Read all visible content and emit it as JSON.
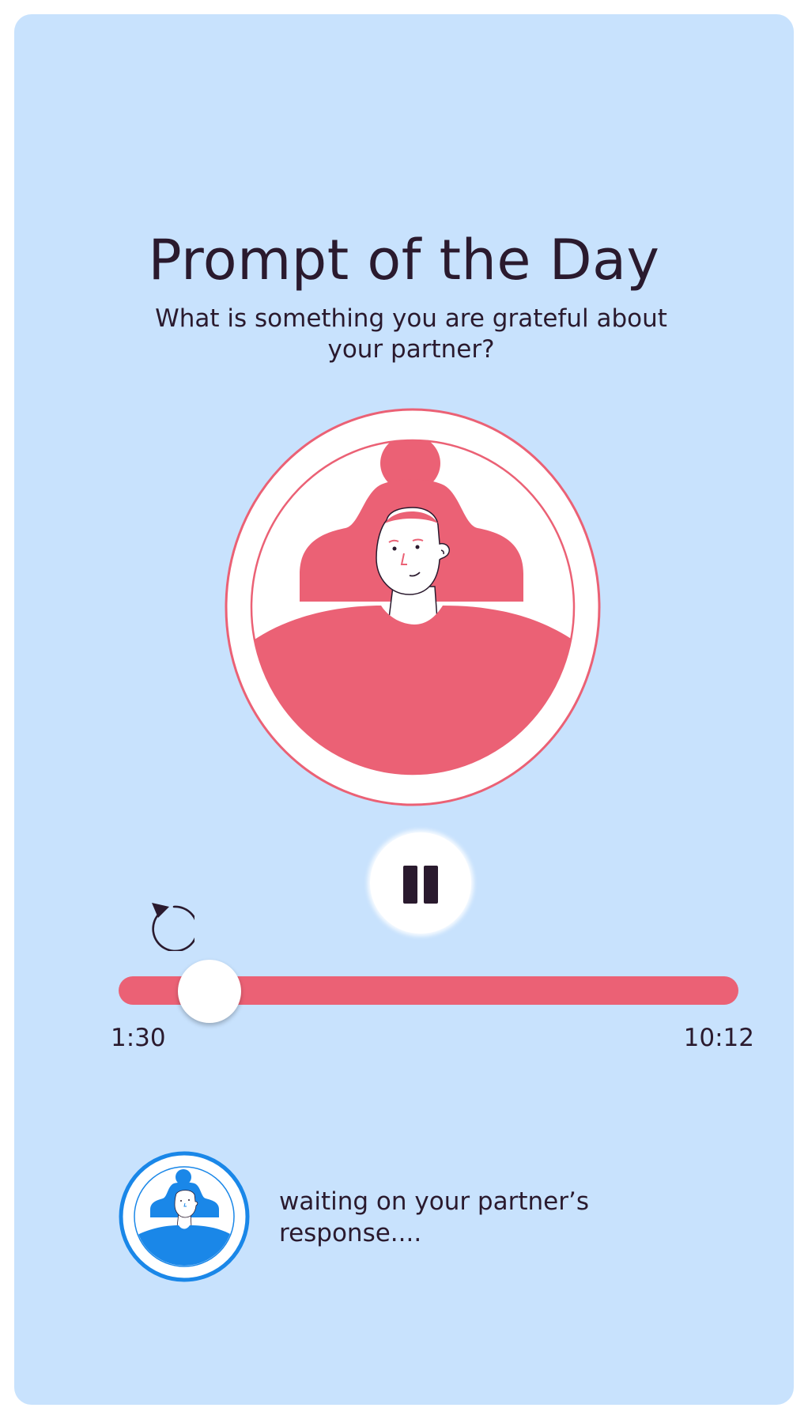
{
  "prompt": {
    "title": "Prompt of the Day",
    "question": "What is something you are grateful about your partner?"
  },
  "player": {
    "pause_icon": "pause-icon",
    "replay_icon": "replay-icon",
    "elapsed": "1:30",
    "total": "10:12",
    "progress_fraction": 0.147
  },
  "partner": {
    "avatar_icon": "person-avatar",
    "status": "waiting on your partner’s response...."
  },
  "colors": {
    "background": "#c8e2fd",
    "accent_pink": "#eb6175",
    "accent_blue": "#1a87e8",
    "text": "#2a1a2e"
  }
}
